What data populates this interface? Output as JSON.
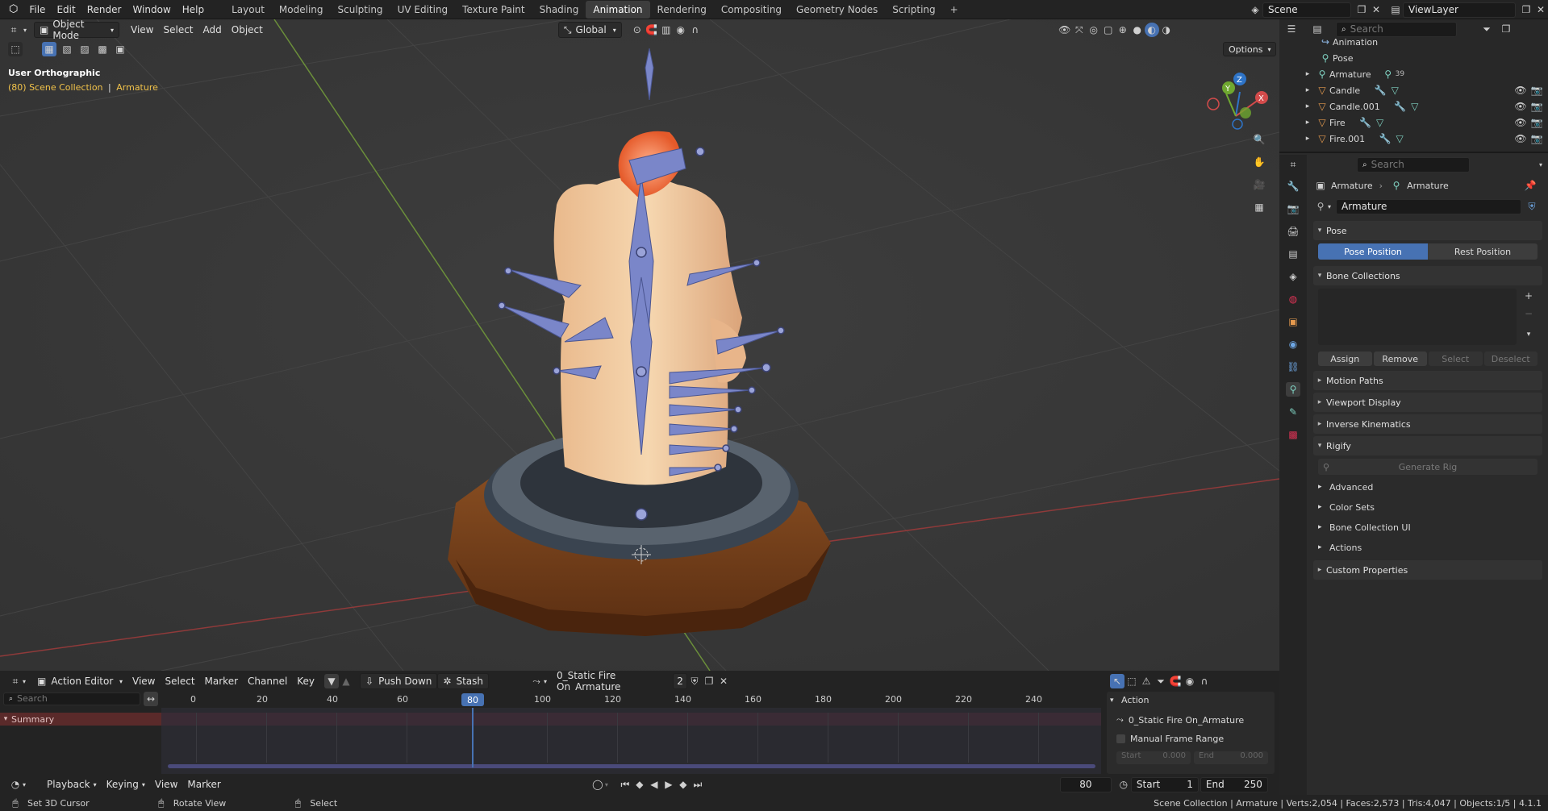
{
  "topbar": {
    "menu": [
      "File",
      "Edit",
      "Render",
      "Window",
      "Help"
    ],
    "workspaces": [
      "Layout",
      "Modeling",
      "Sculpting",
      "UV Editing",
      "Texture Paint",
      "Shading",
      "Animation",
      "Rendering",
      "Compositing",
      "Geometry Nodes",
      "Scripting"
    ],
    "active_workspace": "Animation",
    "add_workspace": "+",
    "scene_label": "Scene",
    "viewlayer_label": "ViewLayer"
  },
  "viewport": {
    "mode": "Object Mode",
    "menus": [
      "View",
      "Select",
      "Add",
      "Object"
    ],
    "transform": "Global",
    "options": "Options",
    "view_name": "User Orthographic",
    "collection_info": "(80) Scene Collection",
    "collection_sep": "|",
    "collection_object": "Armature",
    "gizmo": {
      "x": "X",
      "y": "Y",
      "z": "Z"
    }
  },
  "outliner": {
    "search_placeholder": "Search",
    "rows": [
      {
        "label": "Animation",
        "extra": ""
      },
      {
        "label": "Pose",
        "extra": ""
      },
      {
        "label": "Armature",
        "extra": "39"
      },
      {
        "label": "Candle",
        "extra": ""
      },
      {
        "label": "Candle.001",
        "extra": ""
      },
      {
        "label": "Fire",
        "extra": ""
      },
      {
        "label": "Fire.001",
        "extra": ""
      }
    ]
  },
  "properties": {
    "search_placeholder": "Search",
    "breadcrumb_1": "Armature",
    "breadcrumb_2": "Armature",
    "data_name": "Armature",
    "pose_panel": "Pose",
    "pose_position": "Pose Position",
    "rest_position": "Rest Position",
    "bone_collections": "Bone Collections",
    "assign": "Assign",
    "remove": "Remove",
    "select": "Select",
    "deselect": "Deselect",
    "motion_paths": "Motion Paths",
    "viewport_display": "Viewport Display",
    "inverse_kinematics": "Inverse Kinematics",
    "rigify": "Rigify",
    "generate_rig": "Generate Rig",
    "advanced": "Advanced",
    "color_sets": "Color Sets",
    "bone_collection_ui": "Bone Collection UI",
    "actions": "Actions",
    "custom_properties": "Custom Properties"
  },
  "action_editor": {
    "editor_type": "Action Editor",
    "menus": [
      "View",
      "Select",
      "Marker",
      "Channel",
      "Key"
    ],
    "push_down": "Push Down",
    "stash": "Stash",
    "action_name": "0_Static Fire On_Armature",
    "users": "2",
    "search_placeholder": "Search",
    "ticks": [
      "0",
      "20",
      "40",
      "60",
      "80",
      "100",
      "120",
      "140",
      "160",
      "180",
      "200",
      "220",
      "240"
    ],
    "current_frame": "80",
    "summary": "Summary",
    "side_panel": {
      "title": "Action",
      "action": "0_Static Fire On_Armature",
      "manual_frame_range": "Manual Frame Range",
      "start_label": "Start",
      "start_value": "0.000",
      "end_label": "End",
      "end_value": "0.000"
    }
  },
  "playback": {
    "menus": [
      "Playback",
      "Keying",
      "View",
      "Marker"
    ],
    "frame": "80",
    "start_label": "Start",
    "start_value": "1",
    "end_label": "End",
    "end_value": "250"
  },
  "statusbar": {
    "left_1": "Set 3D Cursor",
    "left_2": "Rotate View",
    "left_3": "Select",
    "stats": "Scene Collection | Armature | Verts:2,054 | Faces:2,573 | Tris:4,047 | Objects:1/5 | 4.1.1"
  },
  "colors": {
    "accent_blue": "#4772b3",
    "bone": "#7a86c9",
    "header": "#232323",
    "viewport_bg": "#393939"
  }
}
